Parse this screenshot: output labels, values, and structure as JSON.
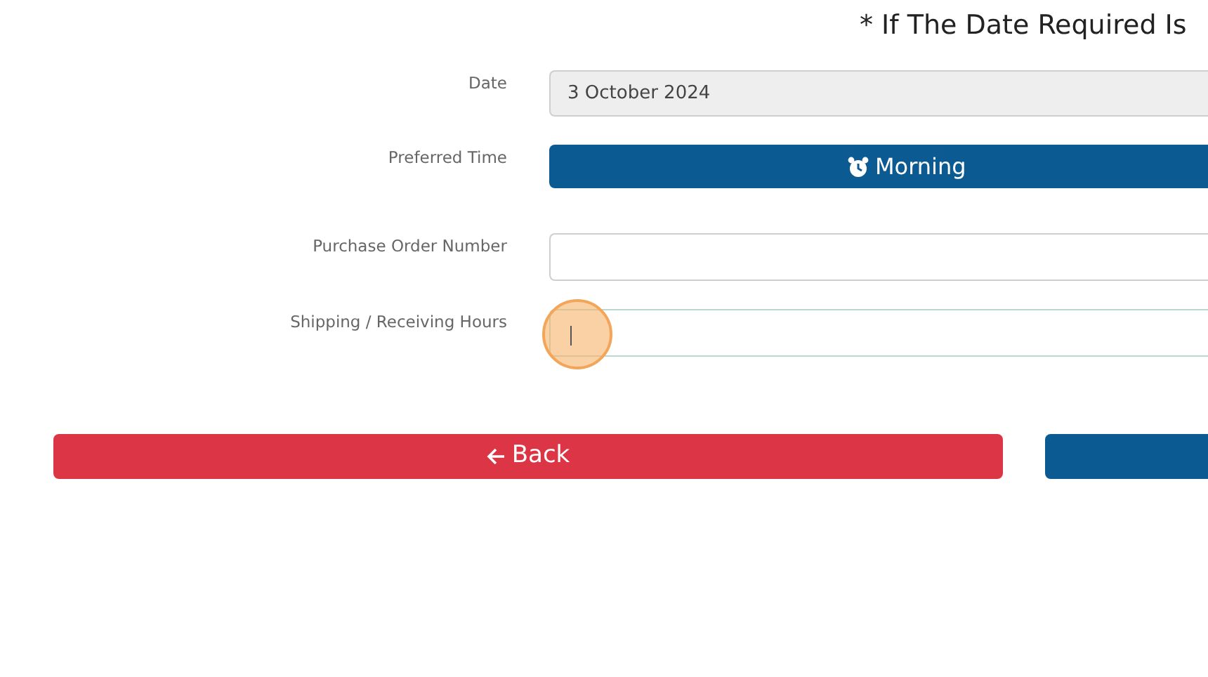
{
  "note": "* If The Date Required Is",
  "fields": [
    {
      "kind": "readonly",
      "label": "Date",
      "value": "3 October 2024",
      "focused": false
    },
    {
      "kind": "button",
      "label": "Preferred Time",
      "value": "Morning",
      "focused": false
    },
    {
      "kind": "input",
      "label": "Purchase Order Number",
      "focused": false
    },
    {
      "kind": "input",
      "label": "Shipping / Receiving Hours",
      "focused": true
    }
  ],
  "buttons": [
    {
      "kind": "back",
      "label": "Back"
    },
    {
      "kind": "next"
    }
  ]
}
